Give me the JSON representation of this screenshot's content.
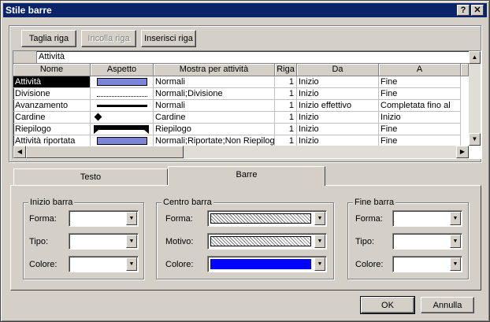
{
  "window": {
    "title": "Stile barre",
    "help_btn": "?",
    "close_btn": "✕"
  },
  "toolbar": {
    "cut": "Taglia riga",
    "paste": "Incolla riga",
    "insert": "Inserisci riga"
  },
  "edit_value": "Attività",
  "columns": [
    "Nome",
    "Aspetto",
    "Mostra per attività",
    "Riga",
    "Da",
    "A"
  ],
  "rows": [
    {
      "name": "Attività",
      "appearance": "bar",
      "show": "Normali",
      "row": "1",
      "from": "Inizio",
      "to": "Fine"
    },
    {
      "name": "Divisione",
      "appearance": "dots",
      "show": "Normali;Divisione",
      "row": "1",
      "from": "Inizio",
      "to": "Fine"
    },
    {
      "name": "Avanzamento",
      "appearance": "line",
      "show": "Normali",
      "row": "1",
      "from": "Inizio effettivo",
      "to": "Completata fino al"
    },
    {
      "name": "Cardine",
      "appearance": "diamond",
      "show": "Cardine",
      "row": "1",
      "from": "Inizio",
      "to": "Inizio"
    },
    {
      "name": "Riepilogo",
      "appearance": "summary",
      "show": "Riepilogo",
      "row": "1",
      "from": "Inizio",
      "to": "Fine"
    },
    {
      "name": "Attività riportata",
      "appearance": "bar",
      "show": "Normali;Riportate;Non Riepilog",
      "row": "1",
      "from": "Inizio",
      "to": "Fine"
    }
  ],
  "tabs": [
    "Testo",
    "Barre"
  ],
  "start_group": {
    "title": "Inizio barra",
    "shape": "Forma:",
    "type": "Tipo:",
    "color": "Colore:"
  },
  "middle_group": {
    "title": "Centro barra",
    "shape": "Forma:",
    "pattern": "Motivo:",
    "color": "Colore:"
  },
  "end_group": {
    "title": "Fine barra",
    "shape": "Forma:",
    "type": "Tipo:",
    "color": "Colore:"
  },
  "colors": {
    "title_bg": "#0a246a",
    "bar_fill": "#7b86d8",
    "middle_color": "#0000ff"
  },
  "ok": "OK",
  "cancel": "Annulla"
}
